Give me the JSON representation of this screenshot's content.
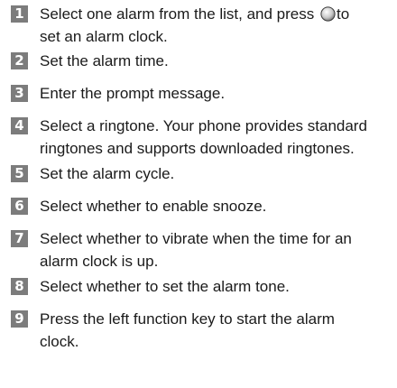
{
  "steps": [
    {
      "number": "1",
      "lines": [
        "Select one alarm from the list, and press",
        "set an alarm clock."
      ],
      "icon": "ok-key-icon",
      "after_icon": "to"
    },
    {
      "number": "2",
      "lines": [
        "Set the alarm time."
      ]
    },
    {
      "number": "3",
      "lines": [
        "Enter the prompt message."
      ]
    },
    {
      "number": "4",
      "lines": [
        "Select a ringtone. Your phone provides standard",
        "ringtones and supports downloaded ringtones."
      ]
    },
    {
      "number": "5",
      "lines": [
        "Set the alarm cycle."
      ]
    },
    {
      "number": "6",
      "lines": [
        "Select whether to enable snooze."
      ]
    },
    {
      "number": "7",
      "lines": [
        "Select whether to vibrate when the time for an",
        "alarm clock is up."
      ]
    },
    {
      "number": "8",
      "lines": [
        "Select whether to set the alarm tone."
      ]
    },
    {
      "number": "9",
      "lines": [
        "Press the left function key to start the alarm",
        "clock."
      ]
    }
  ]
}
